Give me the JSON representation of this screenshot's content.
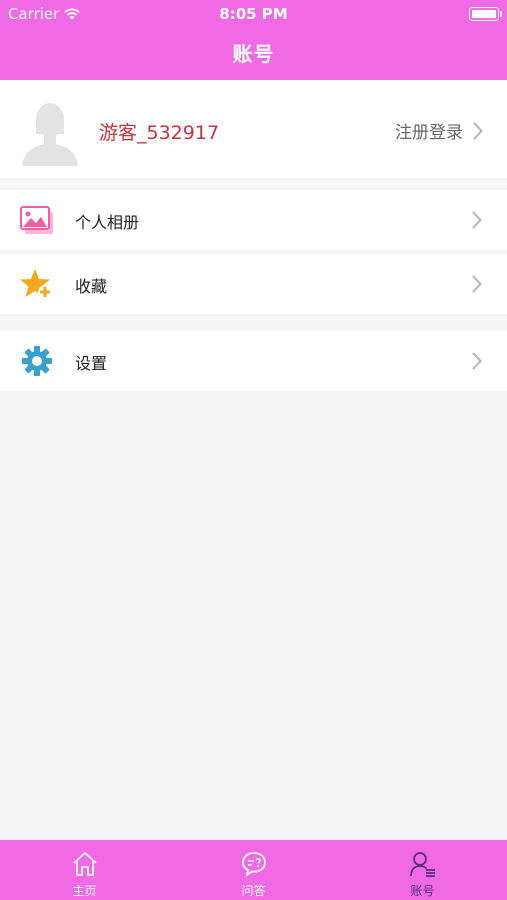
{
  "status": {
    "carrier": "Carrier",
    "time": "8:05 PM"
  },
  "nav": {
    "title": "账号"
  },
  "profile": {
    "username": "游客_532917",
    "login_label": "注册登录"
  },
  "menu": [
    {
      "label": "个人相册",
      "icon": "photo-album-icon"
    },
    {
      "label": "收藏",
      "icon": "star-plus-icon"
    },
    {
      "label": "设置",
      "icon": "gear-icon"
    }
  ],
  "tabs": [
    {
      "label": "主页",
      "icon": "home-icon",
      "active": false
    },
    {
      "label": "问答",
      "icon": "chat-question-icon",
      "active": false
    },
    {
      "label": "账号",
      "icon": "account-icon",
      "active": true
    }
  ],
  "colors": {
    "accent": "#f06ae6",
    "username": "#c8323c",
    "active_tab": "#5a2d7a"
  }
}
